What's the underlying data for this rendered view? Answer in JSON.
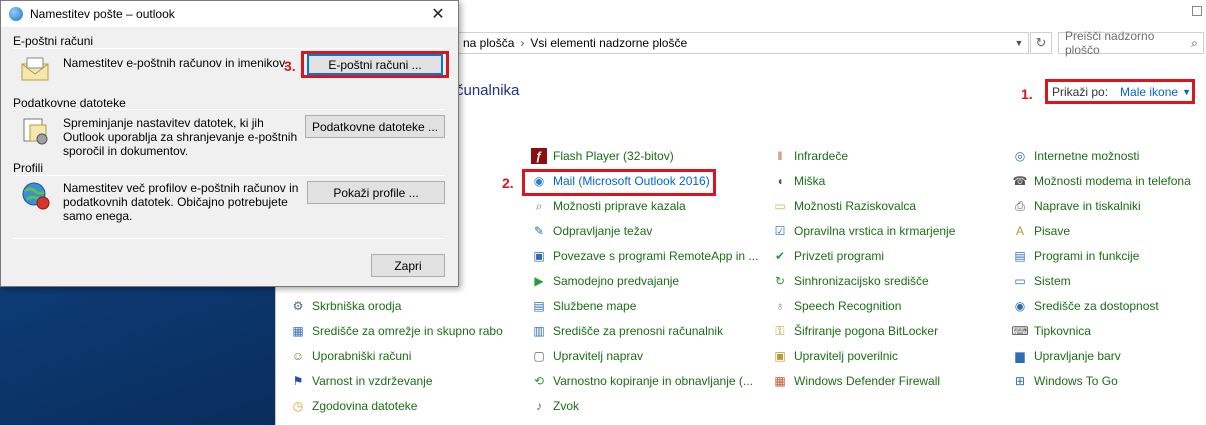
{
  "dialog": {
    "title": "Namestitev pošte – outlook",
    "close_glyph": "✕",
    "sections": [
      {
        "label": "E-poštni računi",
        "text": "Namestitev e-poštnih računov in imenikov.",
        "button": "E-poštni računi ...",
        "step": "3."
      },
      {
        "label": "Podatkovne datoteke",
        "text": "Spreminjanje nastavitev datotek, ki jih Outlook uporablja za shranjevanje e-poštnih sporočil in dokumentov.",
        "button": "Podatkovne datoteke ..."
      },
      {
        "label": "Profili",
        "text": "Namestitev več profilov e-poštnih računov in podatkovnih datotek. Običajno potrebujete samo enega.",
        "button": "Pokaži profile ..."
      }
    ],
    "close_button": "Zapri"
  },
  "control_panel": {
    "breadcrumb": [
      "na plošča",
      "Vsi elementi nadzorne plošče"
    ],
    "search_placeholder": "Preišči nadzorno ploščo",
    "heading": "čunalnika",
    "view_by_label": "Prikaži po:",
    "view_by_value": "Male ikone",
    "step_view": "1.",
    "step_mail": "2.",
    "columns": [
      [
        {
          "label": "Skrbniška orodja",
          "icon": "admin-tools-icon"
        },
        {
          "label": "Središče za omrežje in skupno rabo",
          "icon": "network-icon"
        },
        {
          "label": "Uporabniški računi",
          "icon": "users-icon"
        },
        {
          "label": "Varnost in vzdrževanje",
          "icon": "flag-icon"
        },
        {
          "label": "Zgodovina datoteke",
          "icon": "file-history-icon"
        }
      ],
      [
        {
          "label": "Flash Player (32-bitov)",
          "icon": "flash-icon"
        },
        {
          "label": "Mail (Microsoft Outlook 2016)",
          "icon": "mail-icon"
        },
        {
          "label": "Možnosti priprave kazala",
          "icon": "indexing-icon"
        },
        {
          "label": "Odpravljanje težav",
          "icon": "troubleshoot-icon"
        },
        {
          "label": "Povezave s programi RemoteApp in ...",
          "icon": "remoteapp-icon"
        },
        {
          "label": "Samodejno predvajanje",
          "icon": "autoplay-icon"
        },
        {
          "label": "Službene mape",
          "icon": "work-folders-icon"
        },
        {
          "label": "Središče za prenosni računalnik",
          "icon": "mobility-icon"
        },
        {
          "label": "Upravitelj naprav",
          "icon": "device-manager-icon"
        },
        {
          "label": "Varnostno kopiranje in obnavljanje (...",
          "icon": "backup-icon"
        },
        {
          "label": "Zvok",
          "icon": "sound-icon"
        }
      ],
      [
        {
          "label": "Infrardeče",
          "icon": "infrared-icon"
        },
        {
          "label": "Miška",
          "icon": "mouse-icon"
        },
        {
          "label": "Možnosti Raziskovalca",
          "icon": "folder-options-icon"
        },
        {
          "label": "Opravilna vrstica in krmarjenje",
          "icon": "taskbar-icon"
        },
        {
          "label": "Privzeti programi",
          "icon": "default-programs-icon"
        },
        {
          "label": "Sinhronizacijsko središče",
          "icon": "sync-icon"
        },
        {
          "label": "Speech Recognition",
          "icon": "microphone-icon"
        },
        {
          "label": "Šifriranje pogona BitLocker",
          "icon": "bitlocker-icon"
        },
        {
          "label": "Upravitelj poverilnic",
          "icon": "credential-icon"
        },
        {
          "label": "Windows Defender Firewall",
          "icon": "firewall-icon"
        }
      ],
      [
        {
          "label": "Internetne možnosti",
          "icon": "internet-options-icon"
        },
        {
          "label": "Možnosti modema in telefona",
          "icon": "phone-modem-icon"
        },
        {
          "label": "Naprave in tiskalniki",
          "icon": "printer-icon"
        },
        {
          "label": "Pisave",
          "icon": "fonts-icon"
        },
        {
          "label": "Programi in funkcije",
          "icon": "programs-icon"
        },
        {
          "label": "Sistem",
          "icon": "system-icon"
        },
        {
          "label": "Središče za dostopnost",
          "icon": "accessibility-icon"
        },
        {
          "label": "Tipkovnica",
          "icon": "keyboard-icon"
        },
        {
          "label": "Upravljanje barv",
          "icon": "color-management-icon"
        },
        {
          "label": "Windows To Go",
          "icon": "windows-to-go-icon"
        }
      ]
    ]
  },
  "colors": {
    "highlight": "#d9151e",
    "link_green": "#1a6e14",
    "link_blue": "#0066cc",
    "heading_blue": "#1e3287"
  }
}
